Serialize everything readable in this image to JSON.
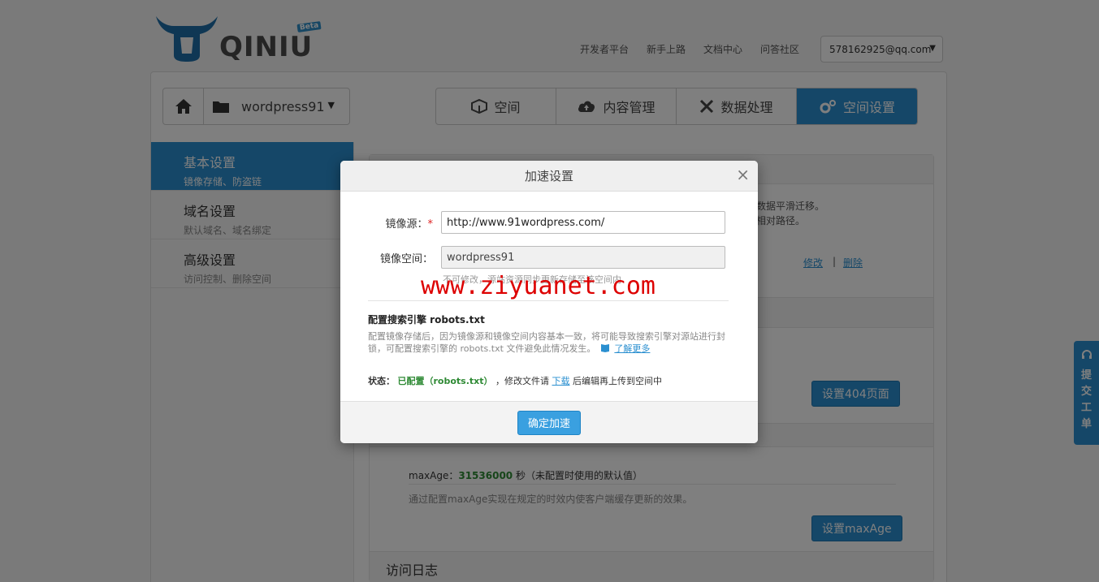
{
  "brand": {
    "logo_text": "QINIU",
    "badge": "Beta"
  },
  "topnav": [
    "开发者平台",
    "新手上路",
    "文档中心",
    "问答社区"
  ],
  "account": {
    "email": "578162925@qq.com"
  },
  "bucket": {
    "name": "wordpress91"
  },
  "tabs": [
    {
      "label": "空间",
      "icon": "cube-icon"
    },
    {
      "label": "内容管理",
      "icon": "cloud-upload-icon"
    },
    {
      "label": "数据处理",
      "icon": "tools-icon"
    },
    {
      "label": "空间设置",
      "icon": "gears-icon",
      "active": true
    }
  ],
  "sidebar": {
    "items": [
      {
        "title": "基本设置",
        "subtitle": "镜像存储、防盗链",
        "active": true
      },
      {
        "title": "域名设置",
        "subtitle": "默认域名、域名绑定"
      },
      {
        "title": "高级设置",
        "subtitle": "访问控制、删除空间"
      }
    ]
  },
  "content": {
    "mirror_note_1": "数据平滑迁移。",
    "mirror_note_2": "相对路径。",
    "edit_link": "修改",
    "separator": "|",
    "delete_link": "删除",
    "btn_404": "设置404页面",
    "maxage_label": "maxAge：",
    "maxage_value": "31536000",
    "maxage_unit": " 秒（未配置时使用的默认值）",
    "maxage_desc": "通过配置maxAge实现在规定的时效内使客户端缓存更新的效果。",
    "btn_maxage": "设置maxAge",
    "log_title": "访问日志"
  },
  "feedback": {
    "chars": [
      "提",
      "交",
      "工",
      "单"
    ]
  },
  "modal": {
    "title": "加速设置",
    "close": "×",
    "source_label": "镜像源：",
    "source_required": "*",
    "source_value": "http://www.91wordpress.com/",
    "space_label": "镜像空间：",
    "space_value": "wordpress91",
    "space_hint": "不可修改，源站资源同步更新存储至该空间内",
    "robots_title": "配置搜索引擎 robots.txt",
    "robots_desc": "配置镜像存储后，因为镜像源和镜像空间内容基本一致，将可能导致搜索引擎对源站进行封锁，可配置搜索引擎的 robots.txt 文件避免此情况发生。",
    "robots_more": "了解更多",
    "status_label": "状态：",
    "status_value": "已配置（robots.txt）",
    "status_mid": "，修改文件请",
    "status_download": "下载",
    "status_tail": "后编辑再上传到空间中",
    "confirm": "确定加速"
  },
  "watermark": "www.ziyuanet.com",
  "colors": {
    "accent": "#2a8fd0",
    "ok_green": "#2f8a35",
    "required_red": "#d22222"
  }
}
